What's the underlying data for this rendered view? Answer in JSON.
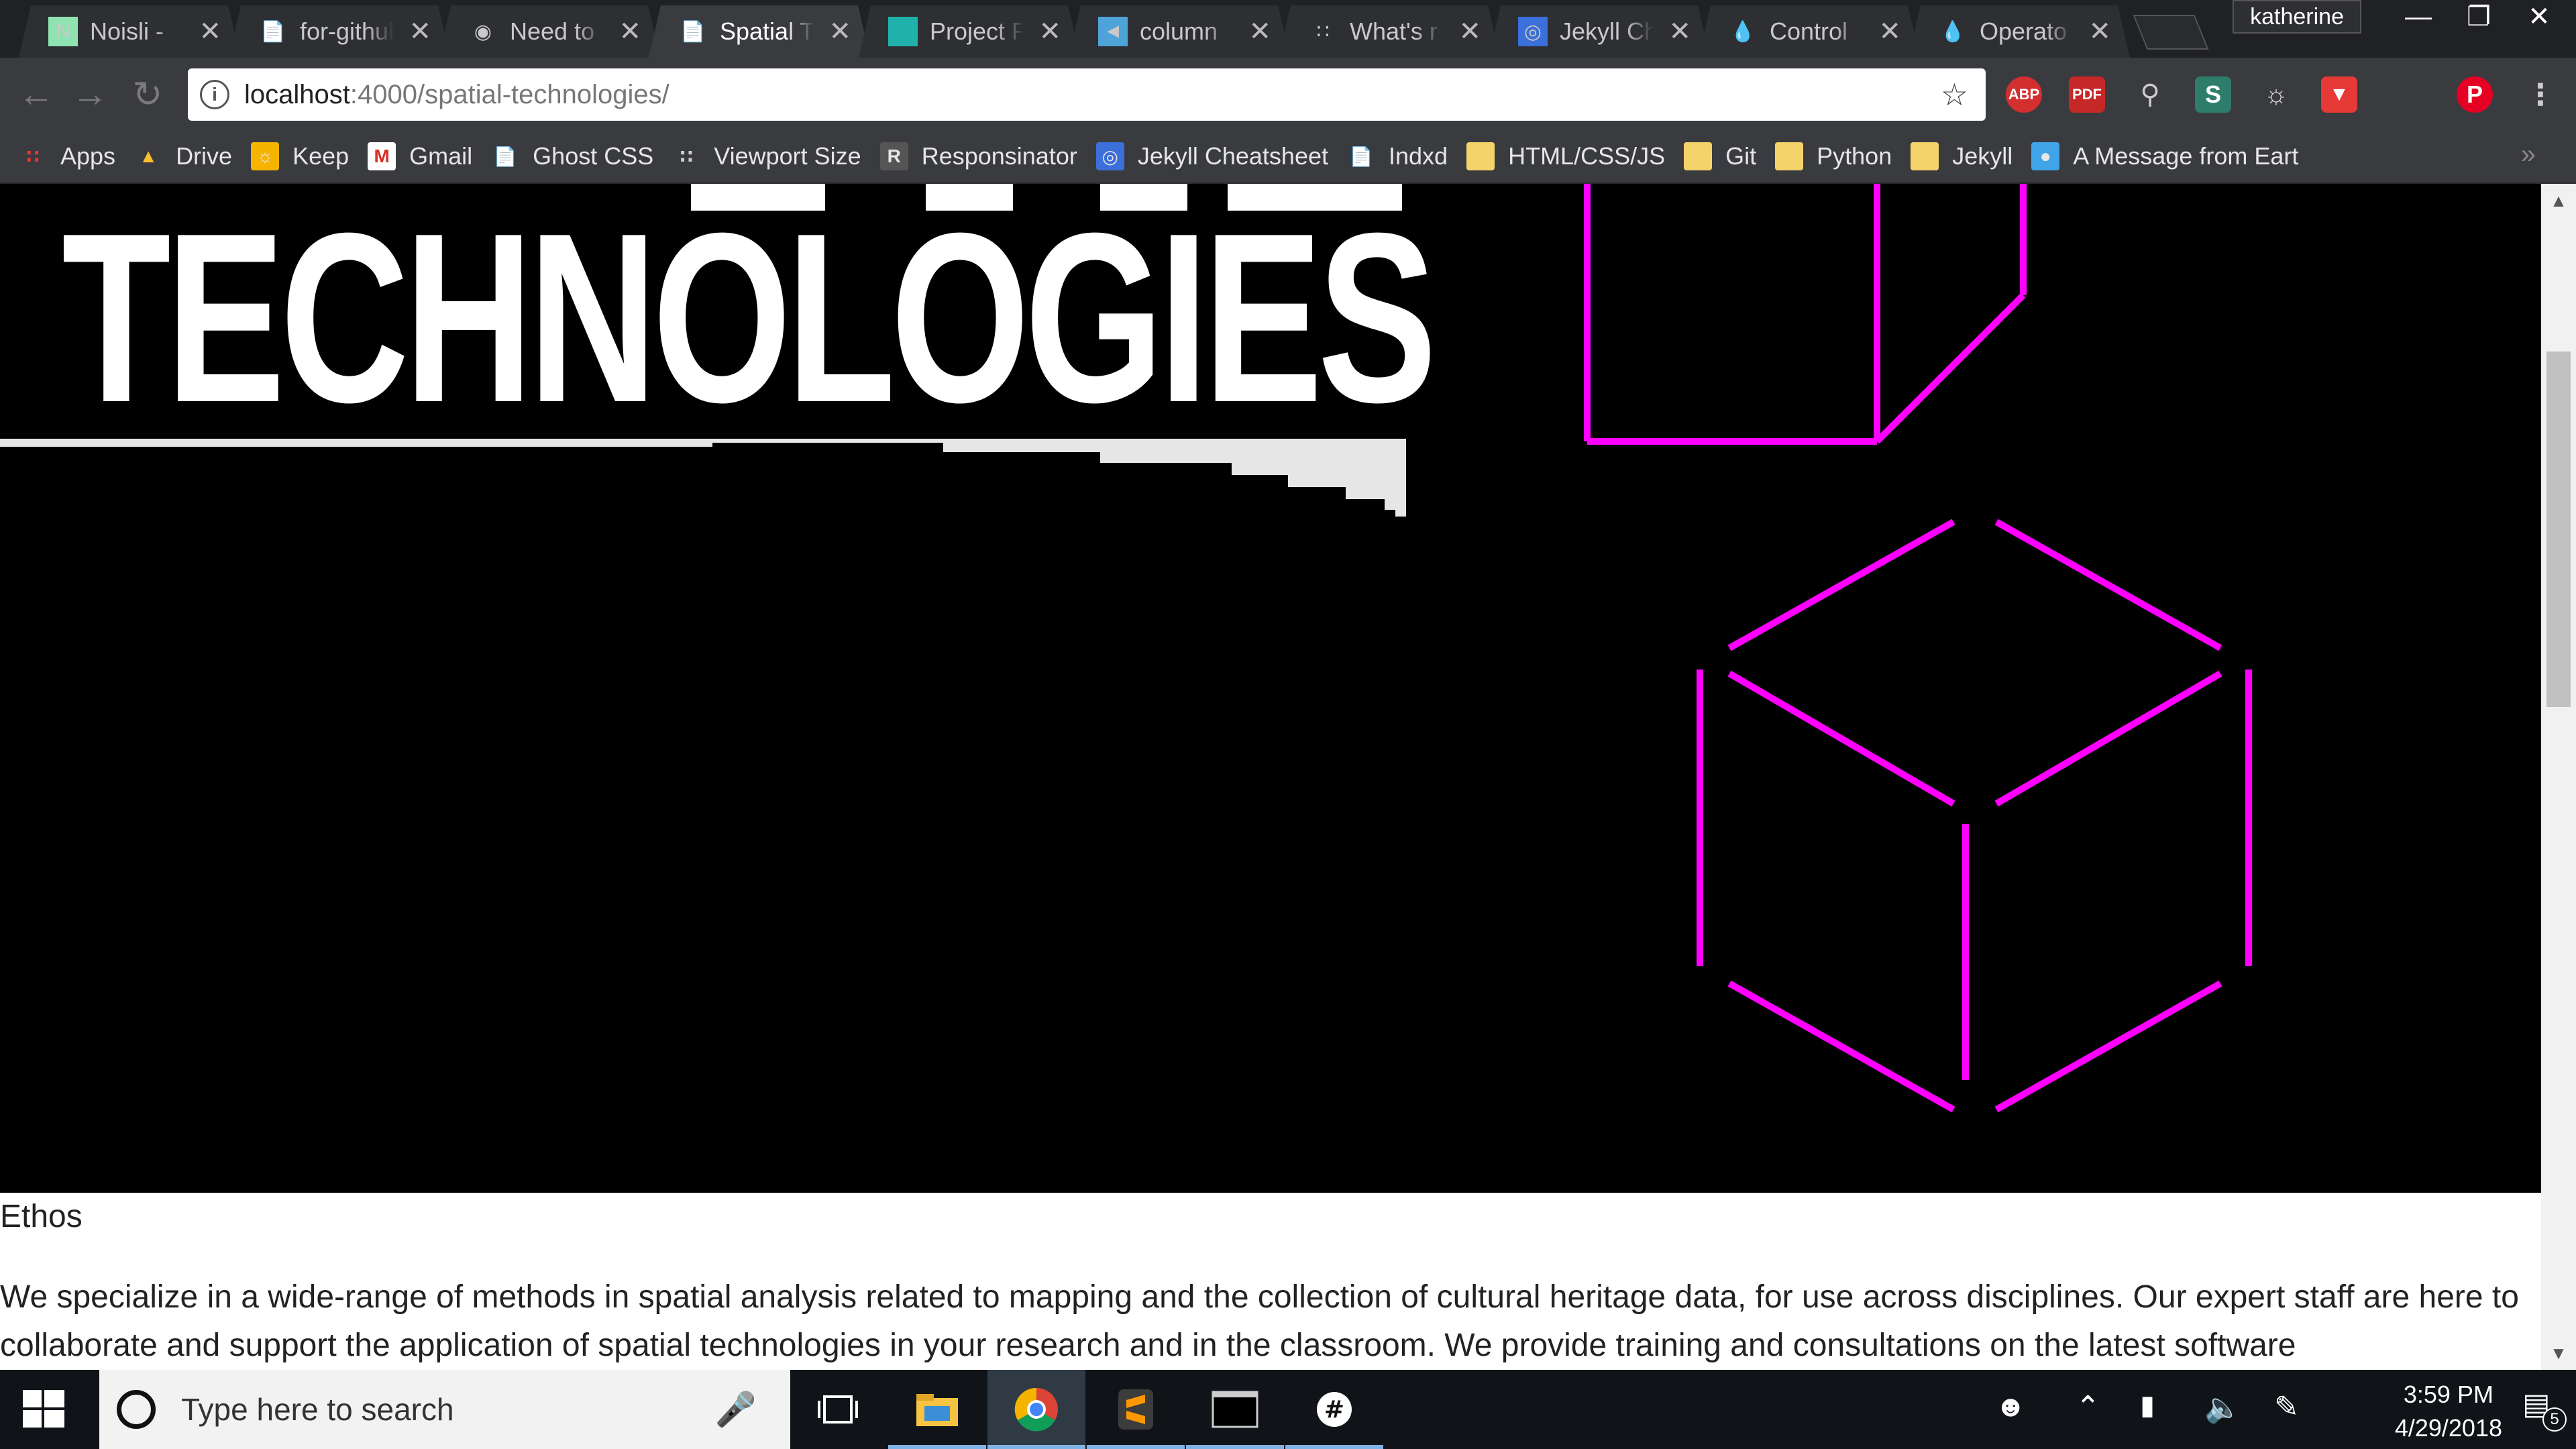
{
  "browser": {
    "tabs": [
      {
        "icon": "noisli-icon",
        "label": "Noisli - ",
        "active": false
      },
      {
        "icon": "page-icon",
        "label": "for-github",
        "active": false
      },
      {
        "icon": "github-icon",
        "label": "Need to",
        "active": false
      },
      {
        "icon": "page-icon",
        "label": "Spatial T",
        "active": true
      },
      {
        "icon": "teal-square-icon",
        "label": "Project F",
        "active": false
      },
      {
        "icon": "column-icon",
        "label": "column",
        "active": false
      },
      {
        "icon": "viewport-icon",
        "label": "What's r",
        "active": false
      },
      {
        "icon": "jekyll-icon",
        "label": "Jekyll Ch",
        "active": false
      },
      {
        "icon": "drop-icon",
        "label": "Control",
        "active": false
      },
      {
        "icon": "drop-icon",
        "label": "Operato",
        "active": false
      }
    ],
    "profile": "katherine",
    "url_host": "localhost",
    "url_rest": ":4000/spatial-technologies/",
    "extensions": [
      "ABP",
      "PDF",
      "Q",
      "S",
      "bulb",
      "pocket",
      "pinterest"
    ],
    "bookmarks": [
      {
        "icon": "apps-icon",
        "label": "Apps"
      },
      {
        "icon": "drive-icon",
        "label": "Drive"
      },
      {
        "icon": "keep-icon",
        "label": "Keep"
      },
      {
        "icon": "gmail-icon",
        "label": "Gmail"
      },
      {
        "icon": "page-icon",
        "label": "Ghost CSS"
      },
      {
        "icon": "viewport-icon",
        "label": "Viewport Size"
      },
      {
        "icon": "r-icon",
        "label": "Responsinator"
      },
      {
        "icon": "jekyll-icon",
        "label": "Jekyll Cheatsheet"
      },
      {
        "icon": "page-icon",
        "label": "Indxd"
      },
      {
        "icon": "folder-icon",
        "label": "HTML/CSS/JS"
      },
      {
        "icon": "folder-icon",
        "label": "Git"
      },
      {
        "icon": "folder-icon",
        "label": "Python"
      },
      {
        "icon": "folder-icon",
        "label": "Jekyll"
      },
      {
        "icon": "earth-icon",
        "label": "A Message from Eart"
      }
    ],
    "more_bookmarks": "»"
  },
  "page": {
    "hero_title": "TECHNOLOGIES",
    "hero_title_partial": "SPATIAL",
    "accent_color": "#ff00ff",
    "section_label": "Ethos",
    "paragraph": "We specialize in a wide-range of methods in spatial analysis related to mapping and the collection of cultural heritage data, for use across disciplines. Our expert staff are here to collaborate and support the application of spatial technologies in your research and in the classroom. We provide training and consultations on the latest software"
  },
  "taskbar": {
    "search_placeholder": "Type here to search",
    "time": "3:59 PM",
    "date": "4/29/2018",
    "notification_count": "5"
  }
}
